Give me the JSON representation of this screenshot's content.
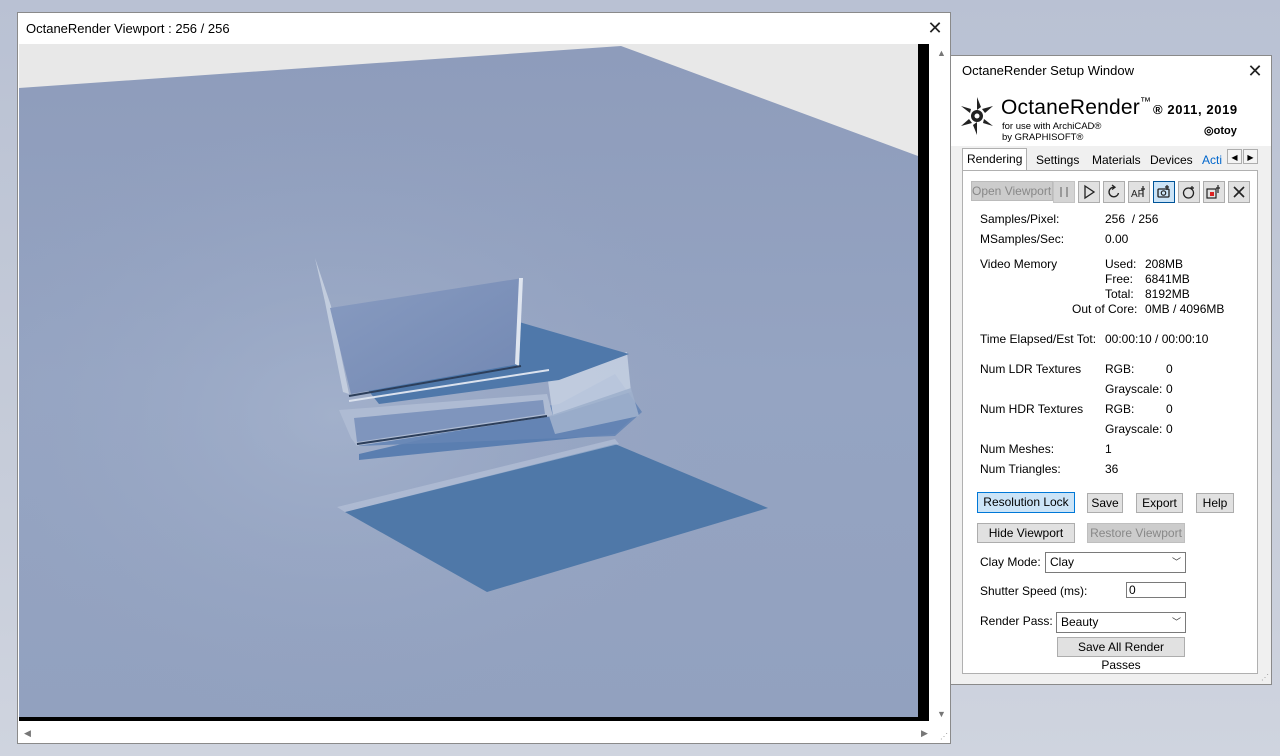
{
  "viewport_window": {
    "title": "OctaneRender Viewport : 256  / 256"
  },
  "setup_window": {
    "title": "OctaneRender Setup Window",
    "logo": {
      "product": "OctaneRender",
      "tm": "™",
      "year": "® 2011, 2019",
      "sub1": "for use with ArchiCAD®",
      "sub2": "by GRAPHISOFT®",
      "vendor": "otoy"
    },
    "tabs": [
      "Rendering",
      "Settings",
      "Materials",
      "Devices",
      "Acti"
    ],
    "toolbar": {
      "open_viewport": "Open Viewport",
      "icons": [
        "pause-icon",
        "play-icon",
        "restart-icon",
        "autofocus-icon",
        "camera-pick-icon",
        "camera-reset-icon",
        "material-pick-icon",
        "stop-icon"
      ]
    },
    "stats": {
      "samples_label": "Samples/Pixel:",
      "samples_value": "256  / 256",
      "msamples_label": "MSamples/Sec:",
      "msamples_value": "0.00",
      "video_memory_label": "Video Memory",
      "used_label": "Used:",
      "used_value": "208MB",
      "free_label": "Free:",
      "free_value": "6841MB",
      "total_label": "Total:",
      "total_value": "8192MB",
      "ooc_label": "Out of Core:",
      "ooc_value": "0MB / 4096MB",
      "time_label": "Time Elapsed/Est Tot:",
      "time_value": "00:00:10 / 00:00:10",
      "ldr_label": "Num LDR Textures",
      "hdr_label": "Num HDR Textures",
      "rgb_label": "RGB:",
      "grayscale_label": "Grayscale:",
      "ldr_rgb": "0",
      "ldr_gray": "0",
      "hdr_rgb": "0",
      "hdr_gray": "0",
      "meshes_label": "Num Meshes:",
      "meshes_value": "1",
      "triangles_label": "Num Triangles:",
      "triangles_value": "36"
    },
    "buttons": {
      "resolution_lock": "Resolution Lock",
      "save": "Save",
      "export": "Export",
      "help": "Help",
      "hide_viewport": "Hide Viewport",
      "restore_viewport": "Restore Viewport",
      "save_all_passes": "Save All Render Passes"
    },
    "clay_mode": {
      "label": "Clay Mode:",
      "value": "Clay"
    },
    "shutter_speed": {
      "label": "Shutter Speed (ms):",
      "value": "0"
    },
    "render_pass": {
      "label": "Render Pass:",
      "value": "Beauty"
    }
  },
  "colors": {
    "render_floor": "#8f9fbf",
    "shadow": "#4c77aa",
    "button_focus": "#cce4f7"
  }
}
